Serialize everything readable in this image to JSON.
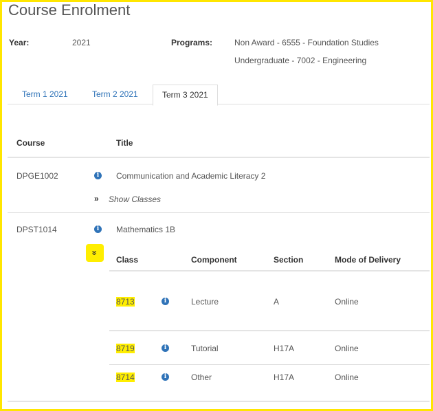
{
  "page": {
    "title": "Course Enrolment"
  },
  "summary": {
    "year_label": "Year:",
    "year_value": "2021",
    "programs_label": "Programs:",
    "programs": [
      "Non Award - 6555 - Foundation Studies",
      "Undergraduate - 7002 - Engineering"
    ]
  },
  "tabs": [
    {
      "label": "Term 1 2021",
      "active": false
    },
    {
      "label": "Term 2 2021",
      "active": false
    },
    {
      "label": "Term 3 2021",
      "active": true
    }
  ],
  "table": {
    "headers": {
      "course": "Course",
      "title": "Title"
    },
    "rows": [
      {
        "code": "DPGE1002",
        "title": "Communication and Academic Literacy 2",
        "show_classes": "Show Classes"
      },
      {
        "code": "DPST1014",
        "title": "Mathematics 1B"
      }
    ]
  },
  "classes": {
    "toggle_glyph": "»",
    "headers": {
      "class": "Class",
      "component": "Component",
      "section": "Section",
      "mode": "Mode of Delivery"
    },
    "rows": [
      {
        "class": "8713",
        "component": "Lecture",
        "section": "A",
        "mode": "Online"
      },
      {
        "class": "8719",
        "component": "Tutorial",
        "section": "H17A",
        "mode": "Online"
      },
      {
        "class": "8714",
        "component": "Other",
        "section": "H17A",
        "mode": "Online"
      }
    ]
  },
  "icons": {
    "info": "info-icon",
    "toggle": "double-chevron-down-icon",
    "show": "double-chevron-right-icon"
  },
  "colors": {
    "highlight": "#ffee00",
    "link": "#2f73b8",
    "border": "#ffe600"
  }
}
